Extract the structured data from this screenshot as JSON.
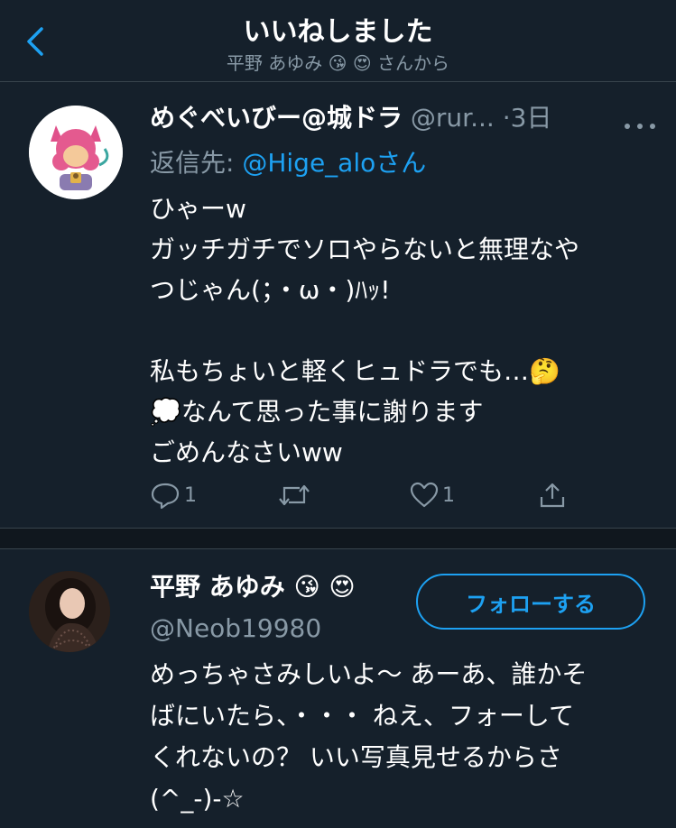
{
  "header": {
    "title": "いいねしました",
    "subtitle": "平野 あゆみ 😘 😍 さんから"
  },
  "tweet": {
    "author_name": "めぐべいびー@城ドラ",
    "author_handle": "@rur...",
    "separator": "·",
    "time": "3日",
    "reply_prefix": "返信先: ",
    "reply_mention": "@Hige_aloさん",
    "body": "ひゃーw\nガッチガチでソロやらないと無理なや\nつじゃん(；・ω・)ﾊｯ!\n\n私もちょいと軽くヒュドラでも…🤔\n💭なんて思った事に謝ります\nごめんなさいww",
    "reply_count": "1",
    "like_count": "1"
  },
  "user": {
    "name": "平野 あゆみ 😘 😍",
    "handle": "@Neob19980",
    "follow_label": "フォローする",
    "bio": "めっちゃさみしいよ〜 あーあ、誰かそ\nばにいたら、・・・ ねえ、フォーして\nくれないの？ いい写真見せるからさ\n(^_-)-☆"
  },
  "icons": {
    "back": "chevron-left-icon",
    "more": "more-dots-icon",
    "reply": "reply-icon",
    "retweet": "retweet-icon",
    "like": "heart-icon",
    "share": "share-icon"
  },
  "colors": {
    "background": "#15202b",
    "accent": "#1da1f2",
    "secondary_text": "#8899a6",
    "divider": "#38444d"
  }
}
